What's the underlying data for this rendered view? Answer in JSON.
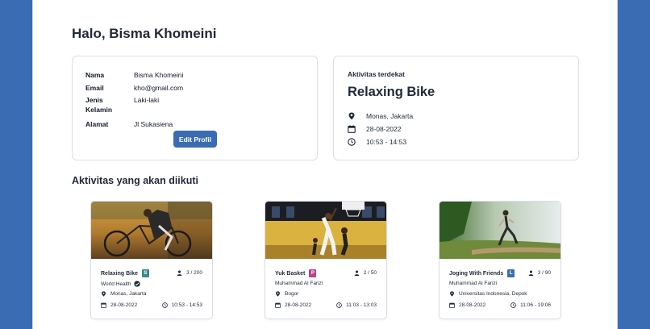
{
  "greeting": "Halo, Bisma Khomeini",
  "profile": {
    "rows": [
      {
        "label": "Nama",
        "value": "Bisma Khomeini"
      },
      {
        "label": "Email",
        "value": "kho@gmail.com"
      },
      {
        "label": "Jenis Kelamin",
        "value": "Laki-laki"
      },
      {
        "label": "Alamat",
        "value": "Jl Sukasiena"
      }
    ],
    "edit_label": "Edit Profil"
  },
  "nearest": {
    "heading": "Aktivitas terdekat",
    "title": "Relaxing Bike",
    "location": "Monas, Jakarta",
    "date": "28-08-2022",
    "time": "10:53 - 14:53"
  },
  "section_title": "Aktivitas yang akan diikuti",
  "activities": [
    {
      "title": "Relaxing Bike",
      "badge": "S",
      "badge_color": "#3a8a8a",
      "quota": "3 / 200",
      "organizer": "World Health",
      "verified": true,
      "location": "Monas, Jakarta",
      "date": "28-08-2022",
      "time": "10:53 - 14:53",
      "image": "bike-photo"
    },
    {
      "title": "Yuk Basket",
      "badge": "P",
      "badge_color": "#c2408c",
      "quota": "2 / 50",
      "organizer": "Muhammad Al Farizi",
      "verified": false,
      "location": "Bogor",
      "date": "28-08-2022",
      "time": "11:03 - 13:03",
      "image": "basketball-photo"
    },
    {
      "title": "Joging With Friends",
      "badge": "L",
      "badge_color": "#3a6cb3",
      "quota": "3 / 90",
      "organizer": "Muhammad Al Farizi",
      "verified": false,
      "location": "Universitas Indonesia, Depok",
      "date": "28-08-2022",
      "time": "11:06 - 19:06",
      "image": "jogging-photo"
    }
  ],
  "colors": {
    "primary": "#3a6cb3",
    "background": "#3a6cb3"
  }
}
